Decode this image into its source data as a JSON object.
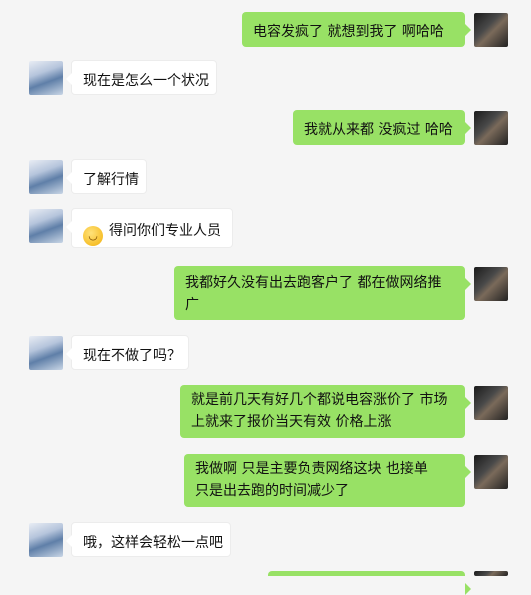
{
  "messages": [
    {
      "side": "right",
      "text": "电容发疯了  就想到我了   啊哈哈"
    },
    {
      "side": "left",
      "text": "现在是怎么一个状况"
    },
    {
      "side": "right",
      "text": "我就从来都 没疯过  哈哈"
    },
    {
      "side": "left",
      "text": "了解行情"
    },
    {
      "side": "left",
      "emoji": "grin-emoji",
      "text": "得问你们专业人员"
    },
    {
      "side": "right",
      "text": "我都好久没有出去跑客户了 都在做网络推广"
    },
    {
      "side": "left",
      "text": "现在不做了吗？"
    },
    {
      "side": "right",
      "lines": [
        "就是前几天有好几个都说电容涨价了    市场",
        "上就来了报价当天有效    价格上涨"
      ]
    },
    {
      "side": "right",
      "lines": [
        "我做啊   只是主要负责网络这块      也接单",
        "只是出去跑的时间减少了"
      ]
    },
    {
      "side": "left",
      "text": "哦，这样会轻松一点吧"
    }
  ]
}
